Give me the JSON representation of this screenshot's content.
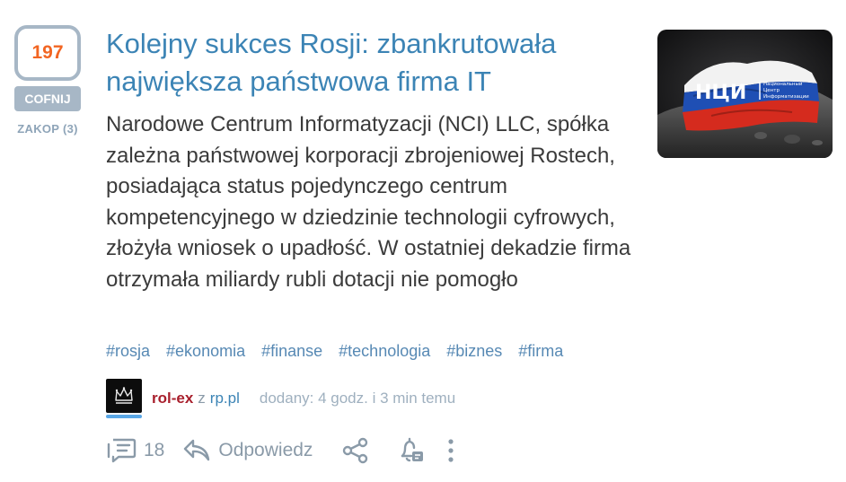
{
  "vote": {
    "count": "197",
    "undo_label": "COFNIJ",
    "bury_label": "ZAKOP (3)"
  },
  "article": {
    "title": "Kolejny sukces Rosji: zbankrutowała największa państwowa firma IT",
    "description": "Narodowe Centrum Informatyzacji (NCI) LLC, spółka zależna państwowej korporacji zbrojeniowej Rostech, posiadająca status pojedynczego centrum kompetencyjnego w dziedzinie technologii cyfrowych, złożyła wniosek o upadłość. W ostatniej dekadzie firma otrzymała miliardy rubli dotacji nie pomogło",
    "thumbnail": {
      "logo_text": "НЦИ",
      "caption_lines": [
        "Национальный",
        "Центр",
        "Информатизации"
      ],
      "flag_colors": [
        "#ffffff",
        "#1f4fb4",
        "#d52b1e"
      ]
    }
  },
  "tags": [
    "#rosja",
    "#ekonomia",
    "#finanse",
    "#technologia",
    "#biznes",
    "#firma"
  ],
  "meta": {
    "author": "rol-ex",
    "from_word": "z",
    "source": "rp.pl",
    "added": "dodany: 4 godz. i 3 min temu"
  },
  "actions": {
    "comments_count": "18",
    "reply_label": "Odpowiedz",
    "icons": [
      "comments-icon",
      "reply-icon",
      "share-icon",
      "notification-bell-icon",
      "more-icon"
    ]
  },
  "colors": {
    "title": "#3c84b5",
    "vote_count": "#f26522",
    "vote_border": "#a7b7c6",
    "author": "#a81f2c",
    "tag": "#5789b4",
    "muted": "#8a9aa8"
  }
}
